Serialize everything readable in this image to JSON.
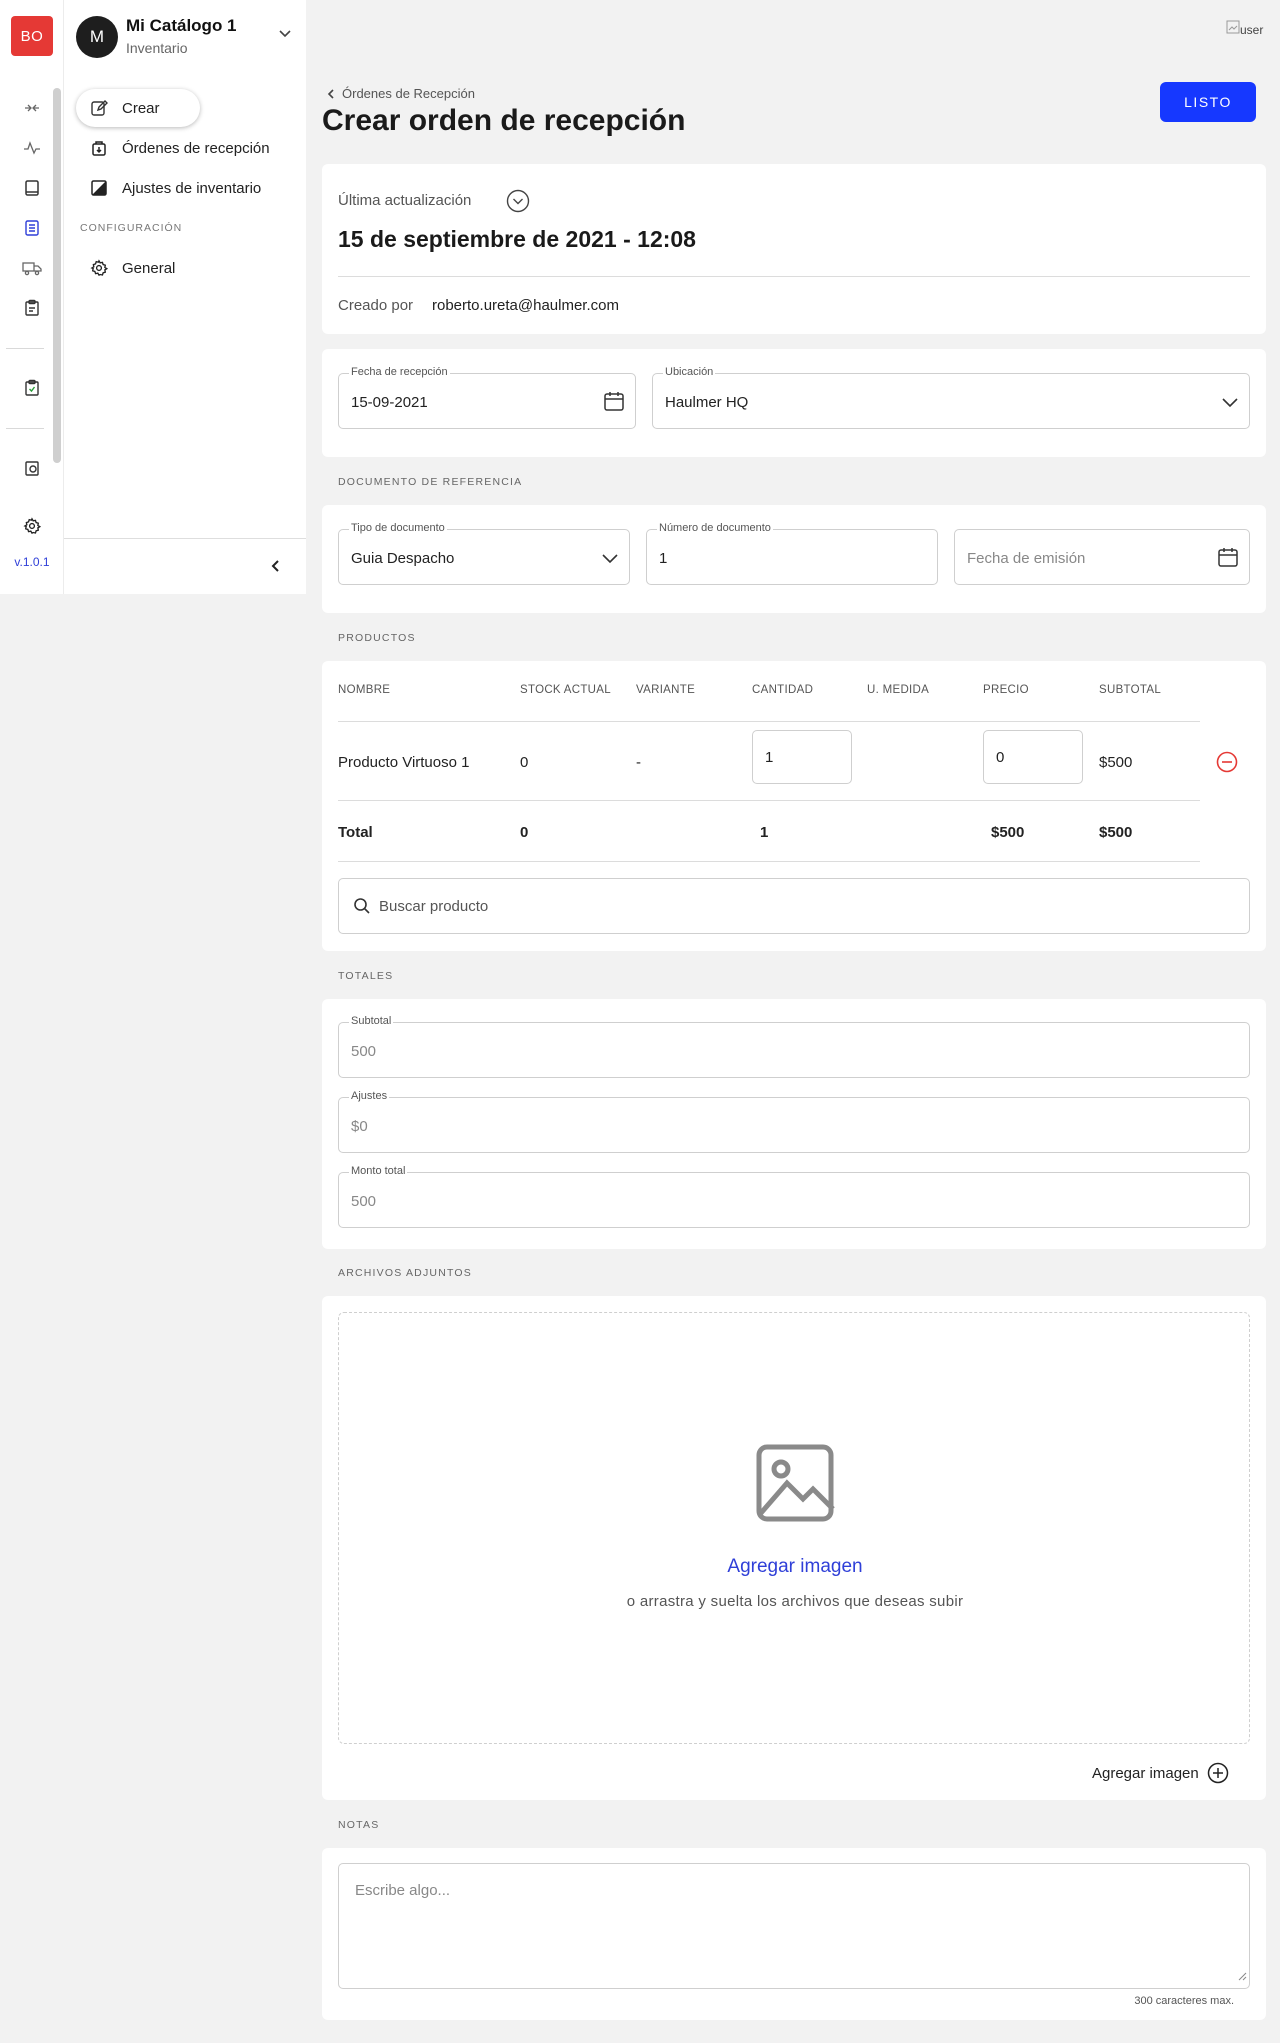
{
  "rail": {
    "logo": "BO",
    "version": "v.1.0.1"
  },
  "catalog": {
    "avatar": "M",
    "title": "Mi Catálogo 1",
    "subtitle": "Inventario"
  },
  "subnav": {
    "items": [
      {
        "label": "Crear"
      },
      {
        "label": "Órdenes de recepción"
      },
      {
        "label": "Ajustes de inventario"
      }
    ],
    "section": "CONFIGURACIÓN",
    "config_items": [
      {
        "label": "General"
      }
    ]
  },
  "user": {
    "img_alt": "user"
  },
  "header": {
    "breadcrumb": "Órdenes de Recepción",
    "title": "Crear orden de recepción",
    "done_label": "LISTO"
  },
  "info": {
    "last_update_label": "Última actualización",
    "last_update_value": "15 de septiembre de 2021 - 12:08",
    "created_by_label": "Creado por",
    "created_by_value": "roberto.ureta@haulmer.com"
  },
  "reception": {
    "date_label": "Fecha de recepción",
    "date_value": "15-09-2021",
    "location_label": "Ubicación",
    "location_value": "Haulmer HQ"
  },
  "reference": {
    "section": "DOCUMENTO DE REFERENCIA",
    "doc_type_label": "Tipo de documento",
    "doc_type_value": "Guia Despacho",
    "doc_number_label": "Número de documento",
    "doc_number_value": "1",
    "issue_date_placeholder": "Fecha de emisión"
  },
  "products": {
    "section": "PRODUCTOS",
    "columns": [
      "NOMBRE",
      "STOCK ACTUAL",
      "VARIANTE",
      "CANTIDAD",
      "U. MEDIDA",
      "PRECIO",
      "SUBTOTAL"
    ],
    "rows": [
      {
        "name": "Producto Virtuoso 1",
        "stock": "0",
        "variant": "-",
        "quantity": "1",
        "unit": "",
        "price": "0",
        "subtotal": "$500"
      }
    ],
    "total": {
      "label": "Total",
      "stock": "0",
      "quantity": "1",
      "price": "$500",
      "subtotal": "$500"
    },
    "search_placeholder": "Buscar producto"
  },
  "totals": {
    "section": "TOTALES",
    "subtotal_label": "Subtotal",
    "subtotal_value": "500",
    "adjust_label": "Ajustes",
    "adjust_value": "$0",
    "total_label": "Monto total",
    "total_value": "500"
  },
  "attachments": {
    "section": "ARCHIVOS ADJUNTOS",
    "add_link": "Agregar imagen",
    "hint": "o arrastra y suelta los archivos que deseas subir",
    "add_button": "Agregar imagen"
  },
  "notes": {
    "section": "NOTAS",
    "placeholder": "Escribe algo...",
    "limit": "300 caracteres max."
  },
  "colors": {
    "primary": "#1638ff",
    "logo": "#e53935",
    "danger": "#e53935",
    "link": "#2f3fd8"
  }
}
